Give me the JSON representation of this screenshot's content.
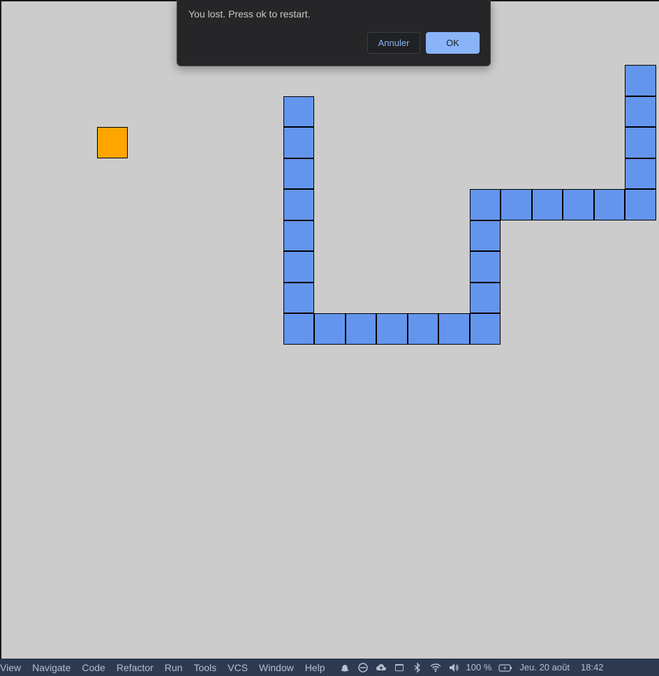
{
  "dialog": {
    "message": "You lost. Press ok to restart.",
    "cancel_label": "Annuler",
    "ok_label": "OK"
  },
  "game": {
    "grid_size": 21,
    "food": [
      3,
      4
    ],
    "snake": [
      [
        20,
        2
      ],
      [
        20,
        3
      ],
      [
        20,
        4
      ],
      [
        20,
        5
      ],
      [
        20,
        6
      ],
      [
        19,
        6
      ],
      [
        18,
        6
      ],
      [
        17,
        6
      ],
      [
        16,
        6
      ],
      [
        15,
        6
      ],
      [
        15,
        7
      ],
      [
        15,
        8
      ],
      [
        15,
        9
      ],
      [
        15,
        10
      ],
      [
        14,
        10
      ],
      [
        13,
        10
      ],
      [
        12,
        10
      ],
      [
        11,
        10
      ],
      [
        10,
        10
      ],
      [
        9,
        10
      ],
      [
        9,
        9
      ],
      [
        9,
        8
      ],
      [
        9,
        7
      ],
      [
        9,
        6
      ],
      [
        9,
        5
      ],
      [
        9,
        4
      ],
      [
        9,
        3
      ]
    ],
    "colors": {
      "board": "#cccccc",
      "snake": "#6495ed",
      "food": "#ffa500"
    }
  },
  "menubar": {
    "items": [
      "View",
      "Navigate",
      "Code",
      "Refactor",
      "Run",
      "Tools",
      "VCS",
      "Window",
      "Help"
    ],
    "battery": "100 %",
    "date": "Jeu. 20 août",
    "time": "18:42"
  }
}
